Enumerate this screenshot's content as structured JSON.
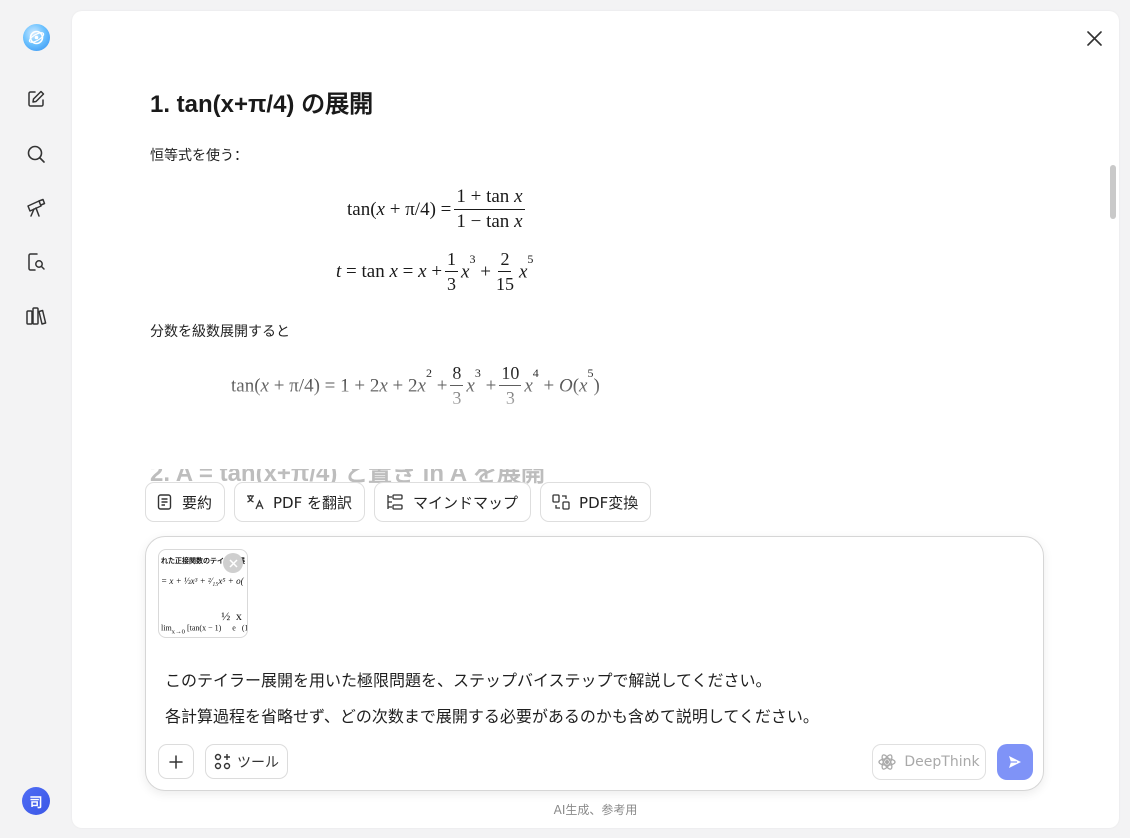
{
  "sidebar": {
    "icons": [
      "new-chat-icon",
      "search-icon",
      "telescope-icon",
      "document-search-icon",
      "library-icon"
    ],
    "avatar_label": "司"
  },
  "article": {
    "heading1": "1. tan(x+π/4) の展開",
    "para1": "恒等式を使う：",
    "para2": "分数を級数展開すると",
    "heading2_partial": "2. A = tan(x+π/4) と置き ln A を展開"
  },
  "actions": {
    "summary": "要約",
    "translate_pdf": "PDF を翻訳",
    "mindmap": "マインドマップ",
    "pdf_convert": "PDF変換"
  },
  "composer": {
    "attachment_title": "れた正接関数のテイラー展",
    "prompt_line1": "このテイラー展開を用いた極限問題を、ステップバイステップで解説してください。",
    "prompt_line2": "各計算過程を省略せず、どの次数まで展開する必要があるのかも含めて説明してください。",
    "tools_label": "ツール",
    "deepthink_label": "DeepThink"
  },
  "footer": {
    "note": "AI生成、参考用"
  },
  "colors": {
    "accent": "#7f93f7",
    "avatar": "#4f6df5"
  }
}
